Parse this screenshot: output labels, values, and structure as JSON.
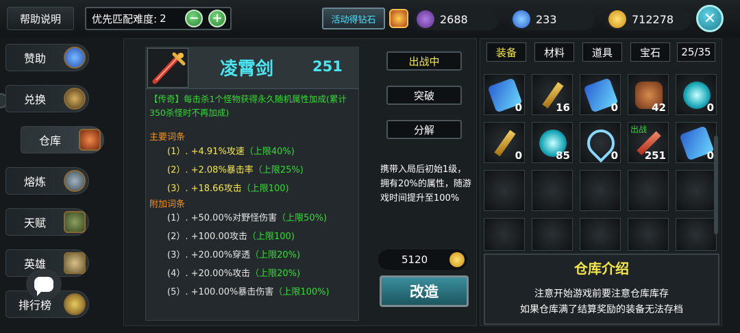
{
  "header": {
    "help_label": "帮助说明",
    "difficulty_label": "优先匹配难度:",
    "difficulty_value": "2",
    "minus_label": "−",
    "plus_label": "+",
    "event_label": "活动得钻石",
    "resources": [
      {
        "icon": "sword-coin-icon",
        "value": "2688"
      },
      {
        "icon": "diamond-icon",
        "value": "233"
      },
      {
        "icon": "gold-coin-icon",
        "value": "712278"
      }
    ],
    "close_label": "✕"
  },
  "sidebar": {
    "items": [
      {
        "label": "赞助",
        "icon": "sponsor-gem-icon"
      },
      {
        "label": "兑换",
        "icon": "exchange-icon"
      },
      {
        "label": "仓库",
        "icon": "warehouse-icon"
      },
      {
        "label": "熔炼",
        "icon": "smelt-icon"
      },
      {
        "label": "天赋",
        "icon": "talent-book-icon"
      },
      {
        "label": "英雄",
        "icon": "hero-scroll-icon"
      },
      {
        "label": "排行榜",
        "icon": "trophy-icon"
      }
    ]
  },
  "detail": {
    "name": "凌霄剑",
    "level": "251",
    "legend_text": "【传奇】每击杀1个怪物获得永久随机属性加成(累计350杀怪时不再加成)",
    "main_title": "主要词条",
    "main_affixes": [
      {
        "text": "(1）. +4.91%攻速",
        "cap": "（上限40%)"
      },
      {
        "text": "(2）. +2.08%暴击率",
        "cap": "（上限25%)"
      },
      {
        "text": "(3）. +18.66攻击",
        "cap": "（上限100)"
      }
    ],
    "extra_title": "附加词条",
    "extra_affixes": [
      {
        "text": "(1）. +50.00%对野怪伤害",
        "cap": "（上限50%)"
      },
      {
        "text": "(2）. +100.00攻击",
        "cap": "（上限100)"
      },
      {
        "text": "(3）. +20.00%穿透",
        "cap": "（上限20%)"
      },
      {
        "text": "(4）. +20.00%攻击",
        "cap": "（上限20%)"
      },
      {
        "text": "(5）. +100.00%暴击伤害",
        "cap": "（上限100%)"
      }
    ]
  },
  "actions": {
    "equipped_label": "出战中",
    "breakthrough_label": "突破",
    "dismantle_label": "分解",
    "description": "携带入局后初始1级，拥有20%的属性，随游戏时间提升至100%",
    "cost": "5120",
    "reforge_label": "改造"
  },
  "inventory": {
    "tabs": [
      "装备",
      "材料",
      "道具",
      "宝石"
    ],
    "capacity": "25/35",
    "slots": [
      {
        "icon": "blaster-gun-icon",
        "count": "0",
        "tag": ""
      },
      {
        "icon": "golden-staff-icon",
        "count": "16",
        "tag": ""
      },
      {
        "icon": "blaster-gun-icon",
        "count": "0",
        "tag": ""
      },
      {
        "icon": "bronze-armor-icon",
        "count": "42",
        "tag": ""
      },
      {
        "icon": "cyan-orb-icon",
        "count": "0",
        "tag": ""
      },
      {
        "icon": "golden-staff-icon",
        "count": "0",
        "tag": ""
      },
      {
        "icon": "cyan-orb-icon",
        "count": "85",
        "tag": ""
      },
      {
        "icon": "ice-bow-icon",
        "count": "0",
        "tag": ""
      },
      {
        "icon": "red-sword-icon",
        "count": "251",
        "tag": "出战"
      },
      {
        "icon": "blaster-gun-icon",
        "count": "0",
        "tag": ""
      }
    ],
    "info_title": "仓库介绍",
    "info_lines": [
      "注意开始游戏前要注意仓库库存",
      "如果仓库满了结算奖励的装备无法存档"
    ]
  }
}
